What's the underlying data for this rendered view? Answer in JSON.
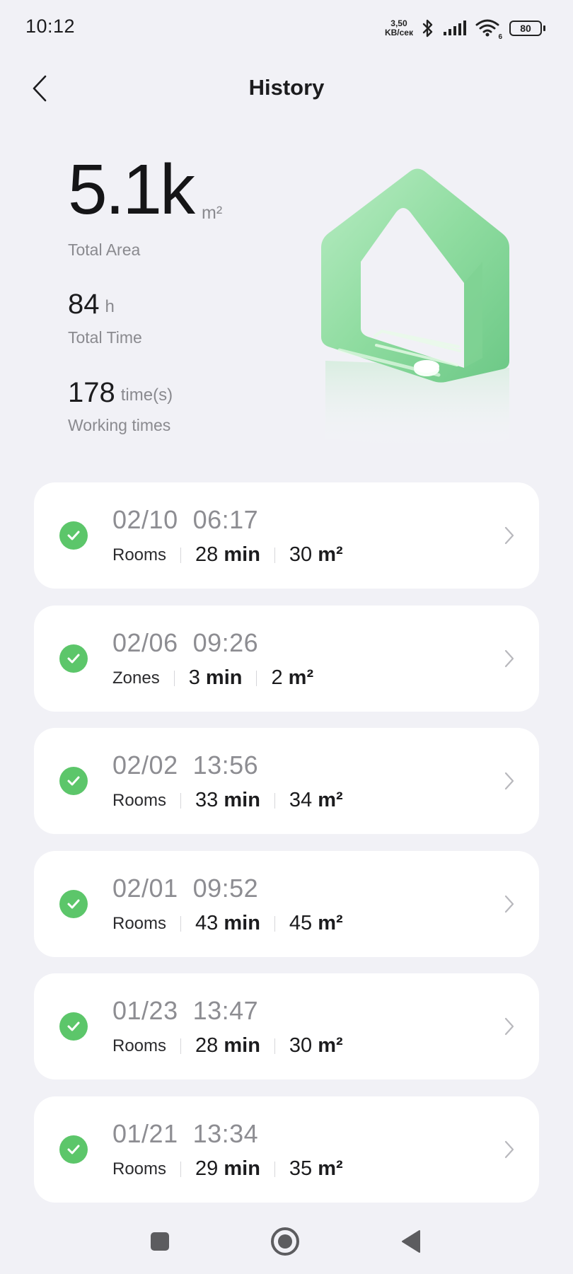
{
  "status_bar": {
    "time": "10:12",
    "net_speed_value": "3,50",
    "net_speed_unit": "KB/сек",
    "wifi_sub": "6",
    "battery": "80"
  },
  "header": {
    "title": "History"
  },
  "stats": {
    "total_area_value": "5.1k",
    "total_area_unit": "m²",
    "total_area_label": "Total Area",
    "total_time_value": "84",
    "total_time_unit": "h",
    "total_time_label": "Total Time",
    "working_times_value": "178",
    "working_times_unit": "time(s)",
    "working_times_label": "Working times"
  },
  "records": [
    {
      "date": "02/10",
      "time": "06:17",
      "mode": "Rooms",
      "duration": "28",
      "duration_unit": "min",
      "area": "30",
      "area_unit": "m²"
    },
    {
      "date": "02/06",
      "time": "09:26",
      "mode": "Zones",
      "duration": "3",
      "duration_unit": "min",
      "area": "2",
      "area_unit": "m²"
    },
    {
      "date": "02/02",
      "time": "13:56",
      "mode": "Rooms",
      "duration": "33",
      "duration_unit": "min",
      "area": "34",
      "area_unit": "m²"
    },
    {
      "date": "02/01",
      "time": "09:52",
      "mode": "Rooms",
      "duration": "43",
      "duration_unit": "min",
      "area": "45",
      "area_unit": "m²"
    },
    {
      "date": "01/23",
      "time": "13:47",
      "mode": "Rooms",
      "duration": "28",
      "duration_unit": "min",
      "area": "30",
      "area_unit": "m²"
    },
    {
      "date": "01/21",
      "time": "13:34",
      "mode": "Rooms",
      "duration": "29",
      "duration_unit": "min",
      "area": "35",
      "area_unit": "m²"
    }
  ],
  "colors": {
    "background": "#f1f1f6",
    "card": "#ffffff",
    "success": "#5cc66a",
    "house_green": "#8fdca0",
    "muted_text": "#8d8d92"
  },
  "icons": {
    "back": "chevron-left-icon",
    "status": "check-circle-icon",
    "row_arrow": "chevron-right-icon",
    "nav_recents": "square-icon",
    "nav_home": "circle-icon",
    "nav_back": "triangle-back-icon"
  }
}
